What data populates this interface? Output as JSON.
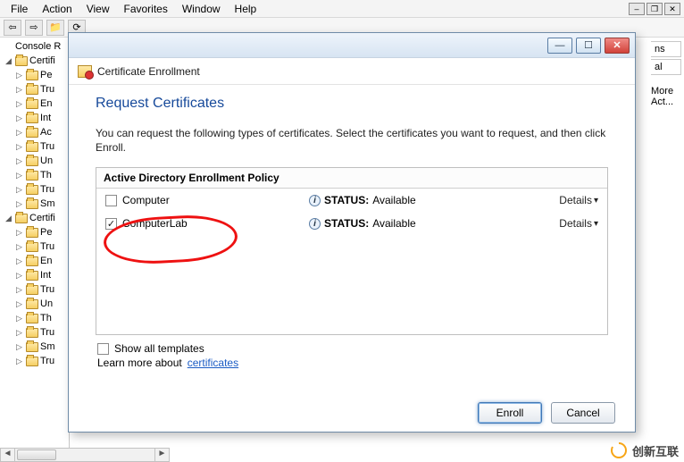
{
  "menu": {
    "items": [
      "File",
      "Action",
      "View",
      "Favorites",
      "Window",
      "Help"
    ]
  },
  "toolbar": {
    "back_prev": "⇦",
    "back_next": "⇨",
    "folder": "📁",
    "refresh": "⟳"
  },
  "tree": {
    "root": "Console R",
    "groups": [
      {
        "label": "Certifi",
        "items": [
          "Pe",
          "Tru",
          "En",
          "Int",
          "Ac",
          "Tru",
          "Un",
          "Th",
          "Tru",
          "Sm"
        ]
      },
      {
        "label": "Certifi",
        "items": [
          "Pe",
          "Tru",
          "En",
          "Int",
          "Tru",
          "Un",
          "Th",
          "Tru",
          "Sm",
          "Tru"
        ]
      }
    ]
  },
  "rightside": {
    "tab1": "ns",
    "tab2": "al",
    "more": "More Act..."
  },
  "dialog": {
    "title": "Certificate Enrollment",
    "heading": "Request Certificates",
    "description": "You can request the following types of certificates. Select the certificates you want to request, and then click Enroll.",
    "policy_header": "Active Directory Enrollment Policy",
    "rows": [
      {
        "checked": false,
        "name": "Computer",
        "status_label": "STATUS:",
        "status_value": "Available",
        "details": "Details"
      },
      {
        "checked": true,
        "name": "ComputerLab",
        "status_label": "STATUS:",
        "status_value": "Available",
        "details": "Details"
      }
    ],
    "show_all": "Show all templates",
    "learn_prefix": "Learn more about ",
    "learn_link": "certificates",
    "enroll": "Enroll",
    "cancel": "Cancel"
  },
  "watermark": "创新互联"
}
